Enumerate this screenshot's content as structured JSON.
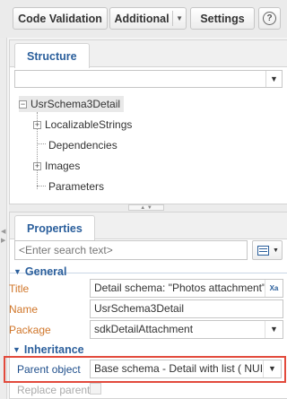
{
  "toolbar": {
    "code_validation": "Code Validation",
    "additional": "Additional",
    "settings": "Settings",
    "help": "?"
  },
  "structure": {
    "tab_label": "Structure",
    "combo_value": "",
    "tree": {
      "root": "UsrSchema3Detail",
      "children": [
        "LocalizableStrings",
        "Dependencies",
        "Images",
        "Parameters"
      ]
    }
  },
  "properties": {
    "tab_label": "Properties",
    "search_placeholder": "<Enter search text>",
    "general": {
      "title": "General",
      "rows": [
        {
          "label": "Title",
          "value": "Detail schema: \"Photos attachment\""
        },
        {
          "label": "Name",
          "value": "UsrSchema3Detail"
        },
        {
          "label": "Package",
          "value": "sdkDetailAttachment"
        }
      ]
    },
    "inheritance": {
      "title": "Inheritance",
      "parent_label": "Parent object",
      "parent_value": "Base schema - Detail with list ( NUI )",
      "replace_label": "Replace parent"
    }
  },
  "colors": {
    "accent": "#2b5f9c",
    "label_orange": "#d0762a",
    "highlight_red": "#e24a3c"
  }
}
